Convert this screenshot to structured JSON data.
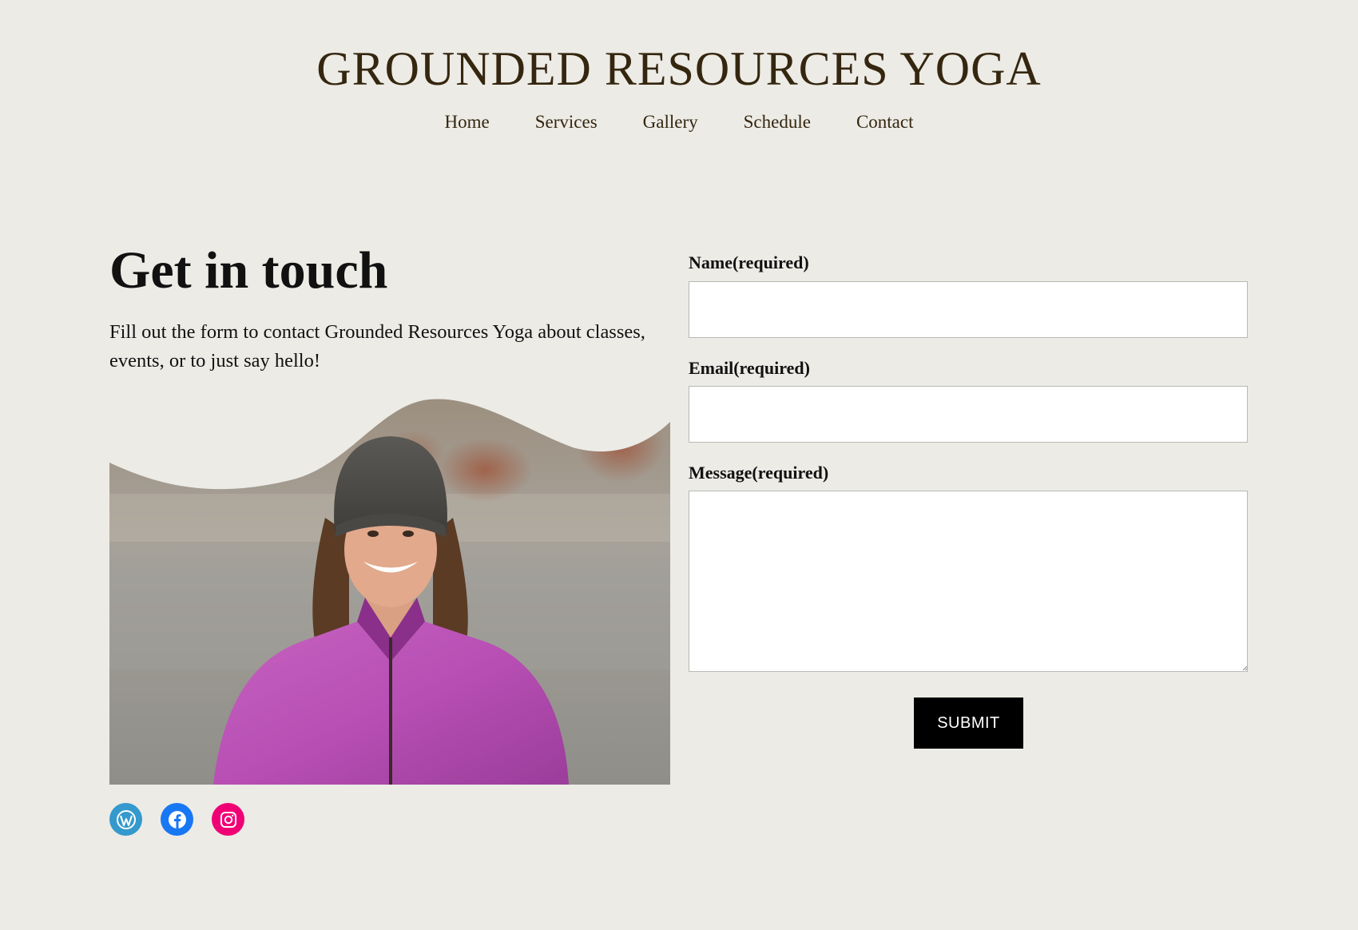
{
  "site": {
    "title": "GROUNDED RESOURCES YOGA"
  },
  "nav": {
    "items": [
      {
        "label": "Home"
      },
      {
        "label": "Services"
      },
      {
        "label": "Gallery"
      },
      {
        "label": "Schedule"
      },
      {
        "label": "Contact"
      }
    ]
  },
  "main": {
    "heading": "Get in touch",
    "intro": "Fill out the form to contact Grounded Resources Yoga about classes, events, or to just say hello!",
    "photo_icon": "portrait-photo"
  },
  "form": {
    "name_label": "Name(required)",
    "name_value": "",
    "email_label": "Email(required)",
    "email_value": "",
    "message_label": "Message(required)",
    "message_value": "",
    "submit_label": "SUBMIT"
  },
  "socials": [
    {
      "icon": "wordpress-icon",
      "color": "#3499cd"
    },
    {
      "icon": "facebook-icon",
      "color": "#1877f2"
    },
    {
      "icon": "instagram-icon",
      "color": "#f00075"
    }
  ],
  "colors": {
    "background": "#ecebe6",
    "title": "#35260f",
    "button": "#000000"
  }
}
